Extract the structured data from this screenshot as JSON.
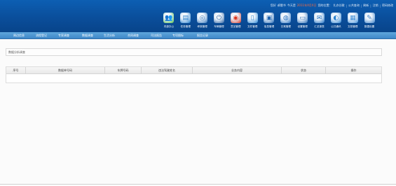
{
  "header": {
    "top_links": [
      {
        "text": "您好",
        "highlight": false
      },
      {
        "text": "郝雷书",
        "highlight": false
      },
      {
        "text": "今天是",
        "highlight": false
      },
      {
        "text": "2011年X月X日",
        "highlight": true
      },
      {
        "text": "您的位置：",
        "highlight": false
      },
      {
        "text": "扎亦谷歌",
        "highlight": false
      },
      {
        "text": "|",
        "highlight": false
      },
      {
        "text": "公共查询",
        "highlight": false
      },
      {
        "text": "|",
        "highlight": false
      },
      {
        "text": "刷新",
        "highlight": false
      },
      {
        "text": "|",
        "highlight": false
      },
      {
        "text": "注销",
        "highlight": false
      },
      {
        "text": "|",
        "highlight": false
      },
      {
        "text": "密码修改",
        "highlight": false
      }
    ],
    "modules": [
      {
        "label": "内部办公",
        "icon": "people-icon",
        "color": "#56c24a"
      },
      {
        "label": "任务管理",
        "icon": "monitor-icon",
        "color": "#1b78c9"
      },
      {
        "label": "考核管理",
        "icon": "gauge-icon",
        "color": "#2c6fb5"
      },
      {
        "label": "车辆管理",
        "icon": "power-icon",
        "color": "#2a5f9e"
      },
      {
        "label": "意见管理",
        "icon": "disc-icon",
        "color": "#d9341f"
      },
      {
        "label": "文件管理",
        "icon": "document-icon",
        "color": "#2d8ad6"
      },
      {
        "label": "信息管理",
        "icon": "screen-icon",
        "color": "#1f64b0"
      },
      {
        "label": "日常管理",
        "icon": "wheel-icon",
        "color": "#2a73c2"
      },
      {
        "label": "设置管理",
        "icon": "printer-icon",
        "color": "#2b6db3"
      },
      {
        "label": "汇总报表",
        "icon": "mail-icon",
        "color": "#1e6fc0"
      },
      {
        "label": "公共通讯",
        "icon": "globe-icon",
        "color": "#2c82cf"
      },
      {
        "label": "文档管理",
        "icon": "box-icon",
        "color": "#3f8fd8"
      },
      {
        "label": "数据设置",
        "icon": "tools-icon",
        "color": "#3a7fc6"
      }
    ]
  },
  "nav": {
    "items": [
      "周边信息",
      "流程登记",
      "专家调查",
      "数据调查",
      "生活分析",
      "合同调查",
      "司法报告",
      "专项图标",
      "报告记录"
    ]
  },
  "panel": {
    "title": "数据分析调查"
  },
  "table": {
    "columns": [
      "序号",
      "数据单号码",
      "车牌号码",
      "违法驾驶姓名",
      "业务内容",
      "状态",
      "操作"
    ],
    "rows": []
  }
}
